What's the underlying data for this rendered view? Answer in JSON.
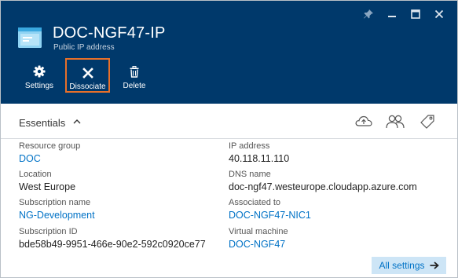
{
  "header": {
    "title": "DOC-NGF47-IP",
    "subtitle": "Public IP address",
    "window_controls": [
      "pin-icon",
      "minimize-icon",
      "maximize-icon",
      "close-icon"
    ]
  },
  "commands": [
    {
      "label": "Settings",
      "icon": "gear-icon",
      "selected": false
    },
    {
      "label": "Dissociate",
      "icon": "close-x-icon",
      "selected": true
    },
    {
      "label": "Delete",
      "icon": "trash-icon",
      "selected": false
    }
  ],
  "essentials": {
    "title": "Essentials",
    "tools": [
      "cloud-upload-icon",
      "users-icon",
      "tag-icon"
    ],
    "left": [
      {
        "label": "Resource group",
        "value": "DOC",
        "link": true
      },
      {
        "label": "Location",
        "value": "West Europe",
        "link": false
      },
      {
        "label": "Subscription name",
        "value": "NG-Development",
        "link": true
      },
      {
        "label": "Subscription ID",
        "value": "bde58b49-9951-466e-90e2-592c0920ce77",
        "link": false
      }
    ],
    "right": [
      {
        "label": "IP address",
        "value": "40.118.11.110",
        "link": false
      },
      {
        "label": "DNS name",
        "value": "doc-ngf47.westeurope.cloudapp.azure.com",
        "link": false
      },
      {
        "label": "Associated to",
        "value": "DOC-NGF47-NIC1",
        "link": true
      },
      {
        "label": "Virtual machine",
        "value": "DOC-NGF47",
        "link": true
      }
    ]
  },
  "all_settings_label": "All settings",
  "colors": {
    "header_bg": "#00396b",
    "link": "#0072c6",
    "selection_border": "#e8702a",
    "all_settings_bg": "#cde5f6"
  }
}
